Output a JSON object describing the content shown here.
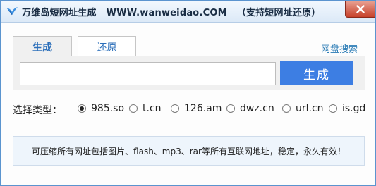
{
  "window": {
    "title": "万维岛短网址生成",
    "url": "WWW.wanweidao.COM",
    "note": "（支持短网址还原）"
  },
  "tabs": [
    {
      "label": "生成",
      "active": true
    },
    {
      "label": "还原",
      "active": false
    }
  ],
  "pan_search_link": "网盘搜索",
  "url_input": {
    "value": "",
    "placeholder": ""
  },
  "generate_button": "生成",
  "radio_group": {
    "label": "选择类型：",
    "selected": "985.so",
    "options": [
      "985.so",
      "t.cn",
      "126.am",
      "dwz.cn",
      "url.cn",
      "is.gd"
    ]
  },
  "info_text": "可压缩所有网址包括图片、flash、mp3、rar等所有互联网地址，稳定，永久有效！",
  "colors": {
    "accent": "#3d7ee3",
    "link": "#2a7bb5",
    "close": "#c7412b"
  }
}
